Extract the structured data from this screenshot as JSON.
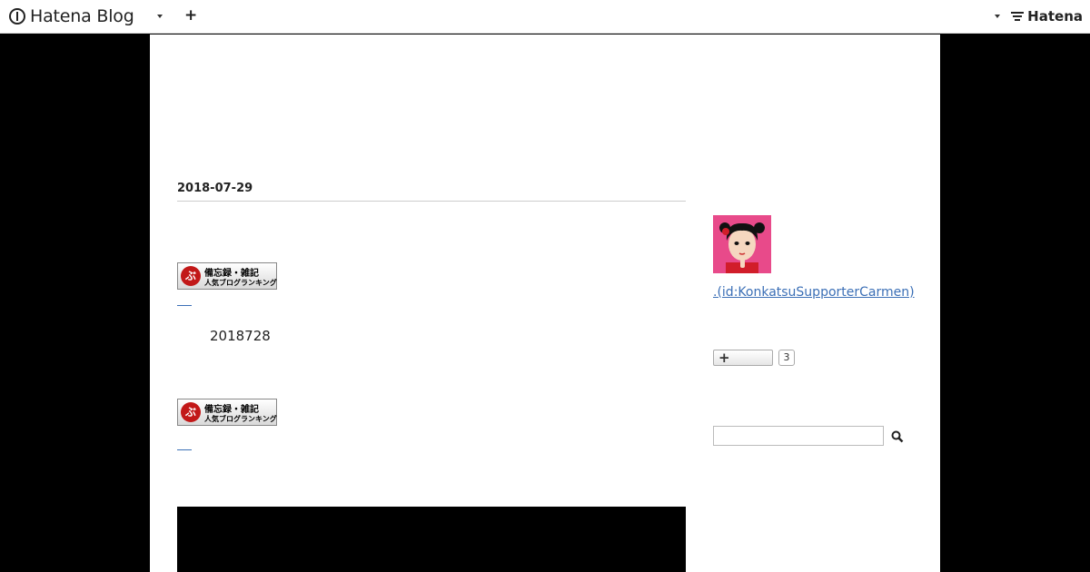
{
  "header": {
    "brand": "Hatena Blog",
    "add_label": "+",
    "hatena_label": "Hatena"
  },
  "entry": {
    "date": "2018-07-29",
    "banner_top": "備忘録・雑記",
    "banner_bottom": "人気ブログランキング",
    "body_text": "2018728"
  },
  "sidebar": {
    "profile_link": ".(id:KonkatsuSupporterCarmen)",
    "subscribe_label": "+",
    "subscriber_count": "3",
    "search_placeholder": ""
  },
  "icons": {
    "brand": "hatena-blog-logo-icon",
    "plus": "plus-icon",
    "search": "magnifier-icon",
    "dropdown": "caret-down-icon"
  },
  "colors": {
    "page_bg": "#000000",
    "content_bg": "#ffffff",
    "link": "#3b6fb6",
    "avatar_bg": "#e84a8a"
  }
}
